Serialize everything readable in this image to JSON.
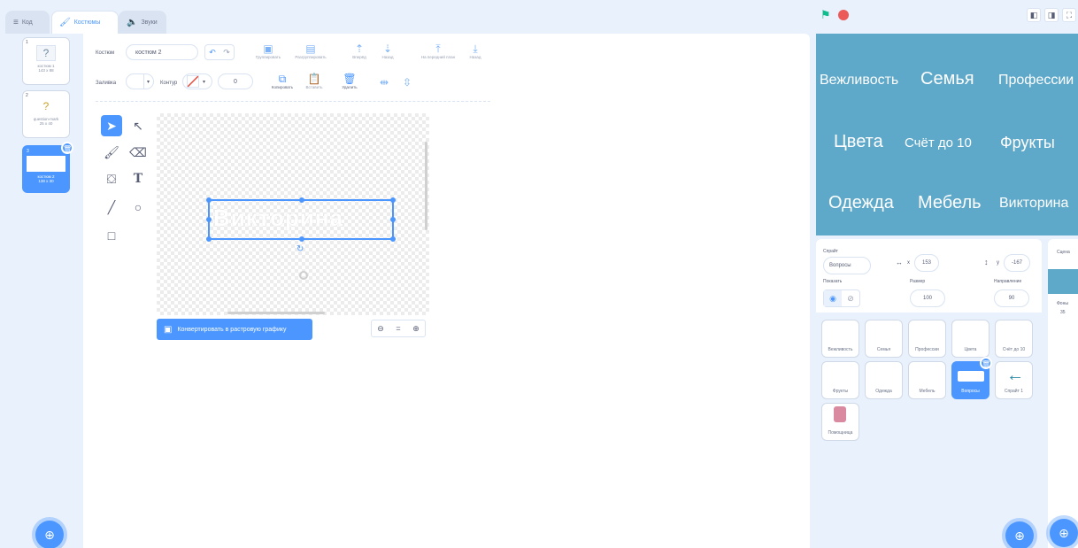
{
  "tabs": {
    "code": "Код",
    "costumes": "Костюмы",
    "sounds": "Звуки"
  },
  "costumes": [
    {
      "num": "1",
      "name": "костюм 1",
      "size": "143 x 88"
    },
    {
      "num": "2",
      "name": "question-mark",
      "size": "25 x 40"
    },
    {
      "num": "3",
      "name": "костюм 2",
      "size": "138 x 30"
    }
  ],
  "editor": {
    "costume_label": "Костюм",
    "costume_name": "костюм 2",
    "fill_label": "Заливка",
    "outline_label": "Контур",
    "outline_width": "0",
    "group": "Группировать",
    "ungroup": "Разгруппировать",
    "forward": "Вперёд",
    "backward": "Назад",
    "front": "На передний план",
    "back": "Назад",
    "copy": "Копировать",
    "paste": "Вставить",
    "delete": "Удалить",
    "canvas_text": "Викторина",
    "convert_button": "Конвертировать в растровую графику",
    "zoom_equal": "="
  },
  "stage_words": [
    {
      "text": "Вежливость"
    },
    {
      "text": "Семья"
    },
    {
      "text": "Профессии"
    },
    {
      "text": "Цвета"
    },
    {
      "text": "Счёт до 10"
    },
    {
      "text": "Фрукты"
    },
    {
      "text": "Одежда"
    },
    {
      "text": "Мебель"
    },
    {
      "text": "Викторина"
    }
  ],
  "sprite_info": {
    "sprite_label": "Спрайт",
    "sprite_name": "Вопросы",
    "x_label": "x",
    "x_value": "153",
    "y_label": "y",
    "y_value": "-167",
    "show_label": "Показать",
    "size_label": "Размер",
    "size_value": "100",
    "direction_label": "Направление",
    "direction_value": "90"
  },
  "sprites": [
    "Вежливость",
    "Семья",
    "Профессии",
    "Цвета",
    "Счёт до 10",
    "Фрукты",
    "Одежда",
    "Мебель",
    "Вопросы",
    "Спрайт 1",
    "Помощница"
  ],
  "stage_panel": {
    "title": "Сцена",
    "backdrops_label": "Фоны",
    "backdrops_count": "35"
  }
}
